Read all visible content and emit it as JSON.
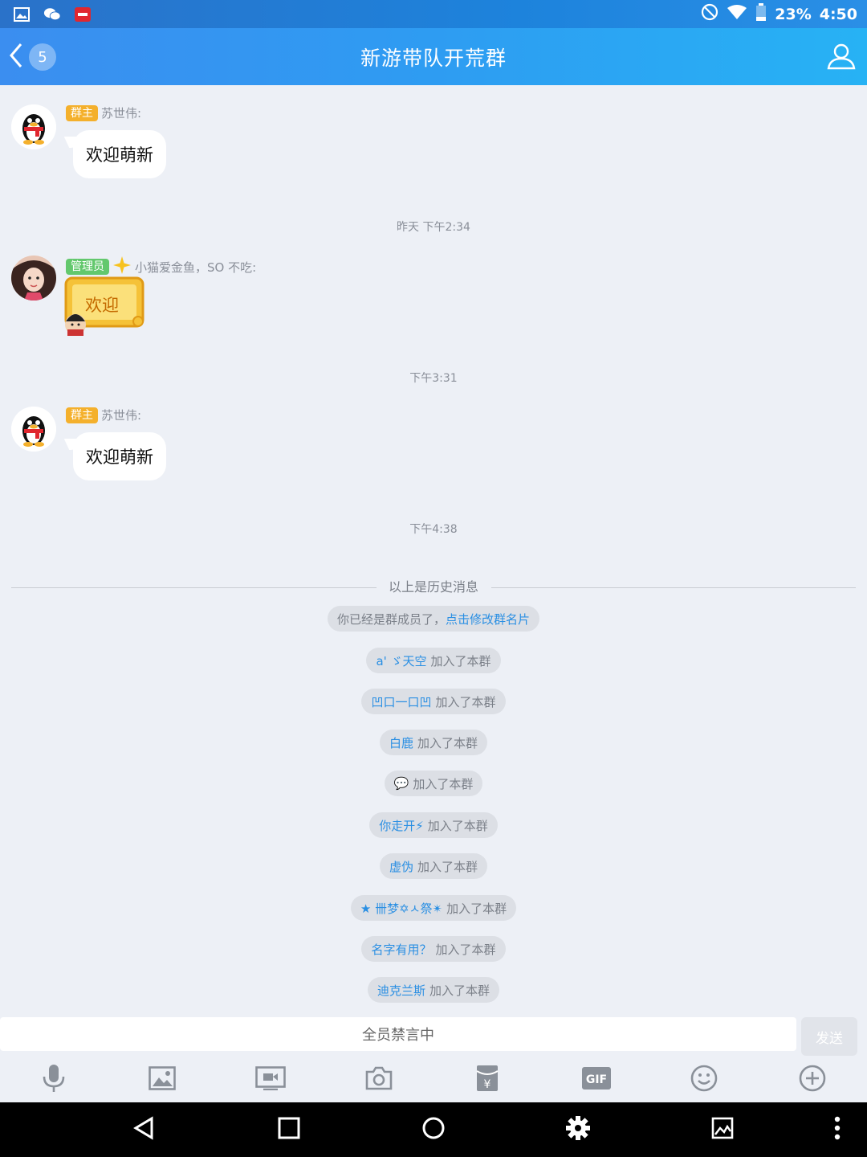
{
  "status_bar": {
    "battery": "23%",
    "time": "4:50",
    "icons": [
      "gallery-icon",
      "wechat-icon",
      "news-app-icon",
      "no-disturb-icon",
      "wifi-icon",
      "battery-icon"
    ]
  },
  "header": {
    "back_count": "5",
    "title": "新游带队开荒群",
    "profile_icon": "group-members-icon"
  },
  "messages": [
    {
      "role_badge": "群主",
      "sender": "苏世伟:",
      "text": "欢迎萌新",
      "avatar": "qq-penguin-avatar"
    },
    {
      "timestamp": "昨天 下午2:34"
    },
    {
      "role_badge": "管理员",
      "sender": "小猫爱金鱼，SO 不吃:",
      "sticker_text": "欢迎",
      "avatar": "girl-photo-avatar"
    },
    {
      "timestamp": "下午3:31"
    },
    {
      "role_badge": "群主",
      "sender": "苏世伟:",
      "text": "欢迎萌新",
      "avatar": "qq-penguin-avatar"
    },
    {
      "timestamp": "下午4:38"
    }
  ],
  "history_divider": "以上是历史消息",
  "system_notice": {
    "text": "你已经是群成员了，",
    "link": "点击修改群名片"
  },
  "join_suffix": "加入了本群",
  "joins": [
    {
      "name": "a' ゞ天空"
    },
    {
      "name": "凹口一口凹"
    },
    {
      "name": "白鹿"
    },
    {
      "name": "💬"
    },
    {
      "name": "你走开⚡"
    },
    {
      "name": "虚伪"
    },
    {
      "name": "★ 卌梦✡ㅅ祭✴"
    },
    {
      "name": "名字有用？"
    },
    {
      "name": "迪克兰斯"
    }
  ],
  "input": {
    "placeholder": "全员禁言中",
    "send_label": "发送"
  },
  "toolbar": [
    "microphone-icon",
    "image-icon",
    "video-call-icon",
    "camera-icon",
    "red-packet-icon",
    "gif-icon",
    "emoji-icon",
    "plus-icon"
  ],
  "nav": [
    "back-icon",
    "home-icon",
    "recents-icon",
    "settings-icon",
    "gallery-icon",
    "more-icon"
  ]
}
